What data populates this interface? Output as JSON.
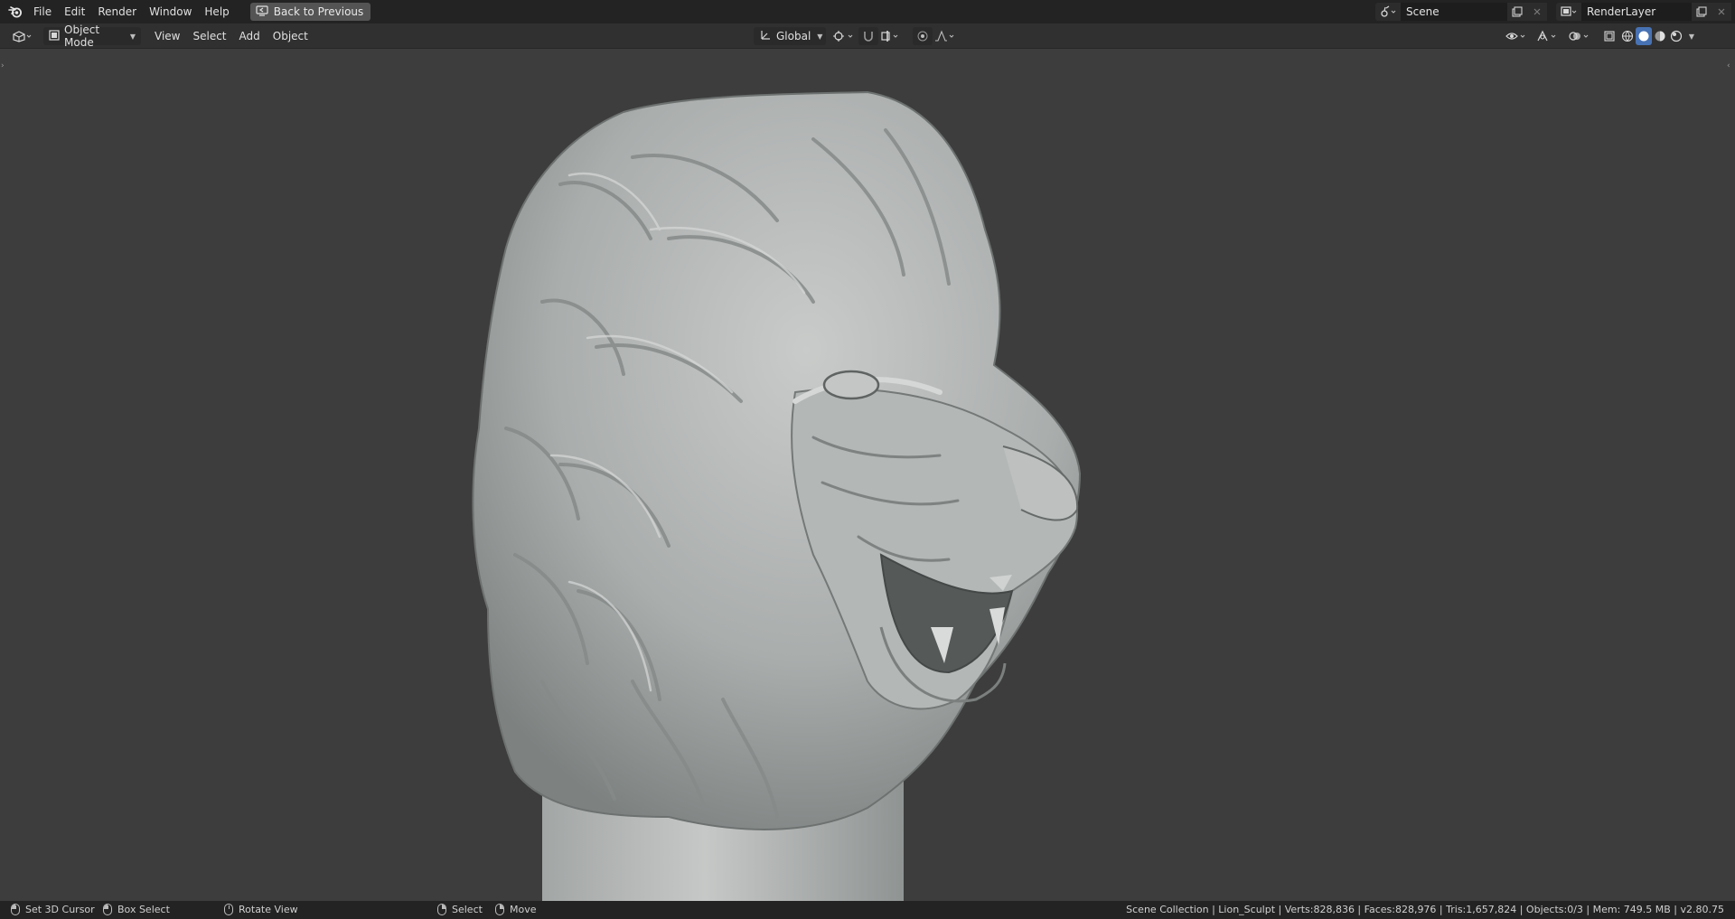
{
  "topbar": {
    "menus": [
      "File",
      "Edit",
      "Render",
      "Window",
      "Help"
    ],
    "back_button": "Back to Previous",
    "scene_name": "Scene",
    "render_layer": "RenderLayer"
  },
  "header": {
    "mode": "Object Mode",
    "menus": [
      "View",
      "Select",
      "Add",
      "Object"
    ],
    "transform_orientation": "Global"
  },
  "statusbar": {
    "hints": [
      {
        "label": "Set 3D Cursor",
        "icon": "mouse-left-icon"
      },
      {
        "label": "Box Select",
        "icon": "mouse-drag-icon"
      },
      {
        "label": "Rotate View",
        "icon": "mouse-middle-icon"
      },
      {
        "label": "Select",
        "icon": "mouse-left-icon"
      },
      {
        "label": "Move",
        "icon": "mouse-drag-icon"
      }
    ],
    "stats": "Scene Collection | Lion_Sculpt | Verts:828,836 | Faces:828,976 | Tris:1,657,824 | Objects:0/3 | Mem: 749.5 MB | v2.80.75"
  },
  "viewport": {
    "object": "lion-sculpt",
    "colors": {
      "background": "#3d3d3d",
      "model": "#b9bcbb",
      "model_shadow": "#6e7372"
    }
  }
}
